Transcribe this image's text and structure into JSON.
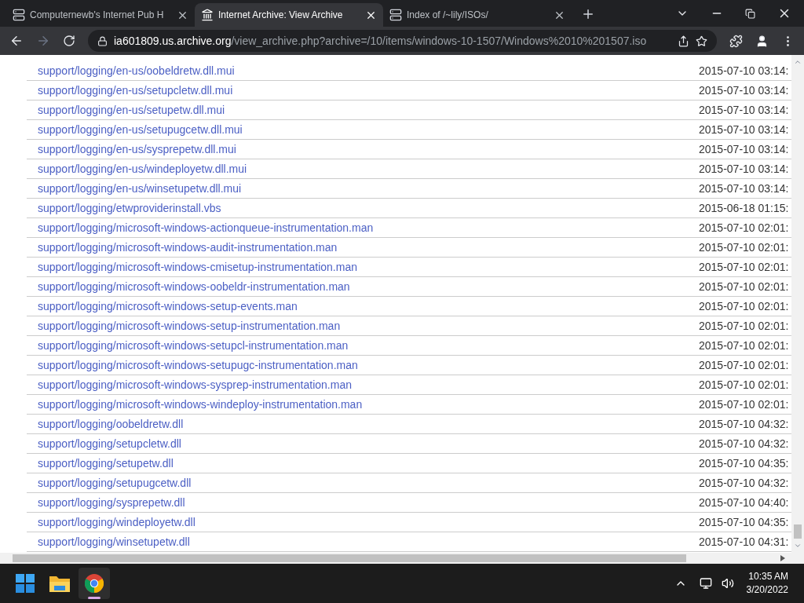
{
  "tabs": [
    {
      "title": "Computernewb's Internet Pub H",
      "selected": false,
      "kind": "server"
    },
    {
      "title": "Internet Archive: View Archive",
      "selected": true,
      "kind": "archive"
    },
    {
      "title": "Index of /~lily/ISOs/",
      "selected": false,
      "kind": "server"
    }
  ],
  "address": {
    "host": "ia601809.us.archive.org",
    "path": "/view_archive.php?archive=/10/items/windows-10-1507/Windows%2010%201507.iso"
  },
  "rows": [
    {
      "file": "support/logging/en-us/oobeldretw.dll.mui",
      "date": "2015-07-10 03:14:"
    },
    {
      "file": "support/logging/en-us/setupcletw.dll.mui",
      "date": "2015-07-10 03:14:"
    },
    {
      "file": "support/logging/en-us/setupetw.dll.mui",
      "date": "2015-07-10 03:14:"
    },
    {
      "file": "support/logging/en-us/setupugcetw.dll.mui",
      "date": "2015-07-10 03:14:"
    },
    {
      "file": "support/logging/en-us/sysprepetw.dll.mui",
      "date": "2015-07-10 03:14:"
    },
    {
      "file": "support/logging/en-us/windeployetw.dll.mui",
      "date": "2015-07-10 03:14:"
    },
    {
      "file": "support/logging/en-us/winsetupetw.dll.mui",
      "date": "2015-07-10 03:14:"
    },
    {
      "file": "support/logging/etwproviderinstall.vbs",
      "date": "2015-06-18 01:15:"
    },
    {
      "file": "support/logging/microsoft-windows-actionqueue-instrumentation.man",
      "date": "2015-07-10 02:01:"
    },
    {
      "file": "support/logging/microsoft-windows-audit-instrumentation.man",
      "date": "2015-07-10 02:01:"
    },
    {
      "file": "support/logging/microsoft-windows-cmisetup-instrumentation.man",
      "date": "2015-07-10 02:01:"
    },
    {
      "file": "support/logging/microsoft-windows-oobeldr-instrumentation.man",
      "date": "2015-07-10 02:01:"
    },
    {
      "file": "support/logging/microsoft-windows-setup-events.man",
      "date": "2015-07-10 02:01:"
    },
    {
      "file": "support/logging/microsoft-windows-setup-instrumentation.man",
      "date": "2015-07-10 02:01:"
    },
    {
      "file": "support/logging/microsoft-windows-setupcl-instrumentation.man",
      "date": "2015-07-10 02:01:"
    },
    {
      "file": "support/logging/microsoft-windows-setupugc-instrumentation.man",
      "date": "2015-07-10 02:01:"
    },
    {
      "file": "support/logging/microsoft-windows-sysprep-instrumentation.man",
      "date": "2015-07-10 02:01:"
    },
    {
      "file": "support/logging/microsoft-windows-windeploy-instrumentation.man",
      "date": "2015-07-10 02:01:"
    },
    {
      "file": "support/logging/oobeldretw.dll",
      "date": "2015-07-10 04:32:"
    },
    {
      "file": "support/logging/setupcletw.dll",
      "date": "2015-07-10 04:32:"
    },
    {
      "file": "support/logging/setupetw.dll",
      "date": "2015-07-10 04:35:"
    },
    {
      "file": "support/logging/setupugcetw.dll",
      "date": "2015-07-10 04:32:"
    },
    {
      "file": "support/logging/sysprepetw.dll",
      "date": "2015-07-10 04:40:"
    },
    {
      "file": "support/logging/windeployetw.dll",
      "date": "2015-07-10 04:35:"
    },
    {
      "file": "support/logging/winsetupetw.dll",
      "date": "2015-07-10 04:31:"
    }
  ],
  "taskbar": {
    "apps": [
      {
        "kind": "start",
        "active": false
      },
      {
        "kind": "explorer",
        "active": false
      },
      {
        "kind": "chrome",
        "active": true
      }
    ],
    "time": "10:35 AM",
    "date": "3/20/2022"
  }
}
